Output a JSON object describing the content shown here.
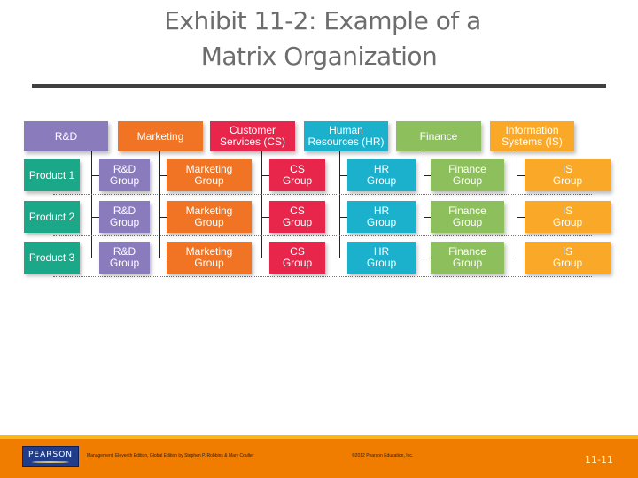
{
  "title": {
    "line1": "Exhibit 11-2: Example of a",
    "line2": "Matrix Organization"
  },
  "departments": [
    {
      "label_lines": [
        "R&D"
      ],
      "color": "#8a7cbc"
    },
    {
      "label_lines": [
        "Marketing"
      ],
      "color": "#f07424"
    },
    {
      "label_lines": [
        "Customer",
        "Services (CS)"
      ],
      "color": "#e8254a"
    },
    {
      "label_lines": [
        "Human",
        "Resources (HR)"
      ],
      "color": "#1bb0cc"
    },
    {
      "label_lines": [
        "Finance"
      ],
      "color": "#8dc05c"
    },
    {
      "label_lines": [
        "Information",
        "Systems (IS)"
      ],
      "color": "#f9a828"
    }
  ],
  "products": [
    {
      "label": "Product 1",
      "color": "#1aa889"
    },
    {
      "label": "Product 2",
      "color": "#1aa889"
    },
    {
      "label": "Product 3",
      "color": "#1aa889"
    }
  ],
  "groups": [
    {
      "label_lines": [
        "R&D",
        "Group"
      ]
    },
    {
      "label_lines": [
        "Marketing",
        "Group"
      ]
    },
    {
      "label_lines": [
        "CS",
        "Group"
      ]
    },
    {
      "label_lines": [
        "HR",
        "Group"
      ]
    },
    {
      "label_lines": [
        "Finance",
        "Group"
      ]
    },
    {
      "label_lines": [
        "IS",
        "Group"
      ]
    }
  ],
  "footer": {
    "logo": "PEARSON",
    "credit": "Management, Eleventh Edition, Global Edition by Stephen P. Robbins & Mary Coulter",
    "copyright": "©2012 Pearson Education, Inc.",
    "page": "11-11",
    "bar_color": "#f07c00",
    "stripe_color": "#f5b820"
  }
}
